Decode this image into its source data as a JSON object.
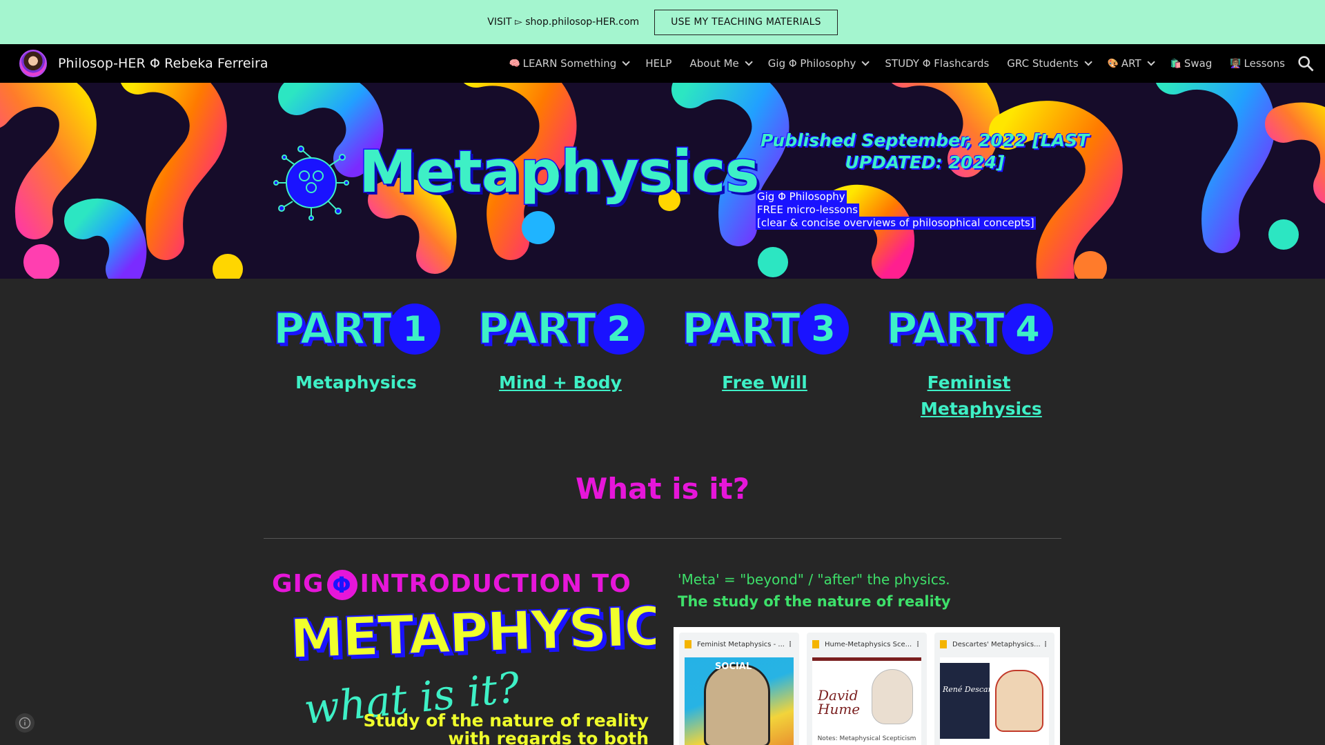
{
  "announcement": {
    "text": "VISIT ▻ shop.philosop-HER.com",
    "button_label": "USE MY TEACHING MATERIALS"
  },
  "nav": {
    "site_title": "Philosop-HER Φ Rebeka Ferreira",
    "items": [
      {
        "emoji": "🧠",
        "label": "LEARN Something",
        "dropdown": true
      },
      {
        "emoji": "",
        "label": "HELP",
        "dropdown": false
      },
      {
        "emoji": "",
        "label": "About Me",
        "dropdown": true
      },
      {
        "emoji": "",
        "label": "Gig Φ Philosophy",
        "dropdown": true
      },
      {
        "emoji": "",
        "label": "STUDY Φ Flashcards",
        "dropdown": false
      },
      {
        "emoji": "",
        "label": "GRC Students",
        "dropdown": true
      },
      {
        "emoji": "🎨",
        "label": "ART",
        "dropdown": true
      },
      {
        "emoji": "🛍️",
        "label": "Swag",
        "dropdown": false
      },
      {
        "emoji": "👩🏽‍🏫",
        "label": "Lessons",
        "dropdown": false
      }
    ],
    "search_icon": "search-icon"
  },
  "hero": {
    "title": "Metaphysics",
    "published": "Published September, 2022 [LAST UPDATED: 2024]",
    "note_lines": [
      "Gig Φ Philosophy",
      "FREE micro-lessons",
      "[clear & concise overviews of philosophical concepts]"
    ]
  },
  "parts": [
    {
      "word": "PART",
      "number": "1",
      "label": "Metaphysics",
      "link": false
    },
    {
      "word": "PART",
      "number": "2",
      "label": "Mind + Body",
      "link": true
    },
    {
      "word": "PART",
      "number": "3",
      "label": "Free Will",
      "link": true
    },
    {
      "word": "PART",
      "number": "4",
      "label": "Feminist Metaphysics",
      "link": true
    }
  ],
  "section": {
    "heading": "What is it?"
  },
  "intro_graphic": {
    "line1_a": "GIG",
    "phi": "Φ",
    "line1_b": "INTRODUCTION TO",
    "line2": "METAPHYSICS",
    "script": "what is it?",
    "desc": "Study of the nature of reality with regards to both"
  },
  "definition": {
    "meta": "'Meta' = \"beyond\" / \"after\" the physics.",
    "study": "The study of the nature of reality"
  },
  "drive_files": [
    {
      "title": "Feminist Metaphysics - ...",
      "thumb_text": "SOCIAL"
    },
    {
      "title": "Hume-Metaphysics Sce...",
      "thumb_text": "David Hume",
      "caption": "Notes: Metaphysical Scepticism"
    },
    {
      "title": "Descartes' Metaphysics...",
      "thumb_text": "René Descartes"
    }
  ],
  "colors": {
    "announce_bg": "#a4f5cf",
    "accent_teal": "#3ef0c6",
    "accent_blue": "#1a13ff",
    "accent_magenta": "#e616d9",
    "accent_yellow": "#f0ff2c",
    "accent_green": "#3ee06a"
  }
}
